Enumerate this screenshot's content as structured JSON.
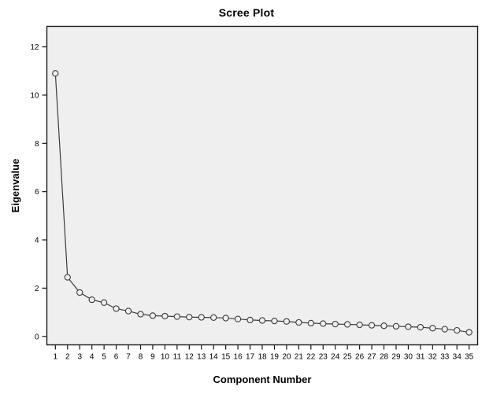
{
  "chart_data": {
    "type": "line",
    "title": "Scree Plot",
    "xlabel": "Component Number",
    "ylabel": "Eigenvalue",
    "x": [
      1,
      2,
      3,
      4,
      5,
      6,
      7,
      8,
      9,
      10,
      11,
      12,
      13,
      14,
      15,
      16,
      17,
      18,
      19,
      20,
      21,
      22,
      23,
      24,
      25,
      26,
      27,
      28,
      29,
      30,
      31,
      32,
      33,
      34,
      35
    ],
    "values": [
      10.9,
      2.45,
      1.82,
      1.52,
      1.4,
      1.15,
      1.05,
      0.92,
      0.86,
      0.84,
      0.82,
      0.8,
      0.79,
      0.78,
      0.76,
      0.72,
      0.68,
      0.66,
      0.64,
      0.62,
      0.58,
      0.55,
      0.53,
      0.51,
      0.5,
      0.48,
      0.46,
      0.44,
      0.42,
      0.4,
      0.38,
      0.34,
      0.3,
      0.25,
      0.17
    ],
    "xtick_labels": [
      "1",
      "2",
      "3",
      "4",
      "5",
      "6",
      "7",
      "8",
      "9",
      "10",
      "11",
      "12",
      "13",
      "14",
      "15",
      "16",
      "17",
      "18",
      "19",
      "20",
      "21",
      "22",
      "23",
      "24",
      "25",
      "26",
      "27",
      "28",
      "29",
      "30",
      "31",
      "32",
      "33",
      "34",
      "35"
    ],
    "ytick_labels": [
      "0",
      "2",
      "4",
      "6",
      "8",
      "10",
      "12"
    ],
    "ytick_values": [
      0,
      2,
      4,
      6,
      8,
      10,
      12
    ],
    "ylim": [
      -0.35,
      12.85
    ],
    "xlim": [
      0.3,
      35.7
    ],
    "grid": false,
    "legend": "none",
    "marker": "open-circle",
    "line_color": "#3c3c3c",
    "marker_edge_color": "#3c3c3c",
    "marker_fill_color": "#efefef",
    "panel_background": "#efefef",
    "panel_border_color": "#1a1a1a",
    "figure_background": "#ffffff"
  }
}
